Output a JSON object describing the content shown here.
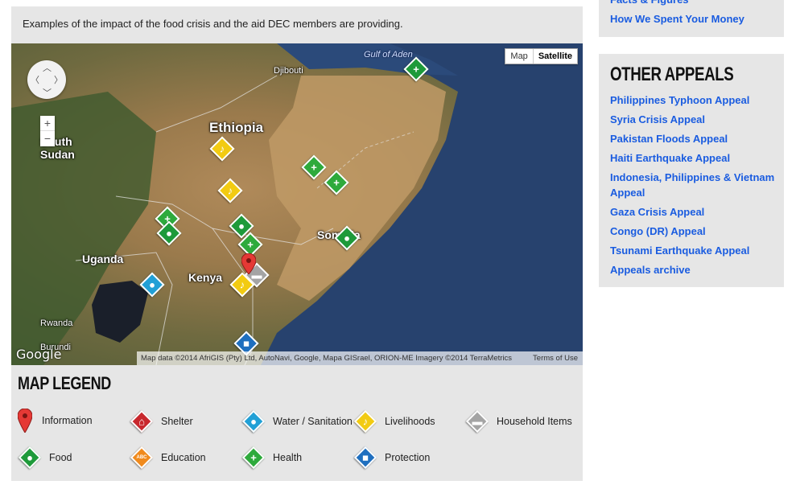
{
  "caption": "Examples of the impact of the food crisis and the aid DEC members are providing.",
  "map": {
    "type_buttons": [
      "Map",
      "Satellite"
    ],
    "selected_type": "Satellite",
    "labels": {
      "djibouti": "Djibouti",
      "ethiopia": "Ethiopia",
      "south": "South",
      "sudan": "Sudan",
      "uganda": "Uganda",
      "kenya": "Kenya",
      "somalia": "Somalia",
      "rwanda": "Rwanda",
      "burundi": "Burundi",
      "gulf": "Gulf of Aden"
    },
    "google_logo": "Google",
    "attribution": "Map data ©2014 AfriGIS (Pty) Ltd, AutoNavi, Google, Mapa GISrael, ORION-ME Imagery ©2014 TerraMetrics",
    "terms": "Terms of Use",
    "zoom_in": "+",
    "zoom_out": "−"
  },
  "legend": {
    "title": "MAP LEGEND",
    "items": [
      {
        "label": "Information",
        "icon": "information-pin-icon",
        "color": "#e53935"
      },
      {
        "label": "Shelter",
        "icon": "shelter-icon",
        "color": "#c8272d"
      },
      {
        "label": "Water / Sanitation",
        "icon": "water-drop-icon",
        "color": "#21a0d6"
      },
      {
        "label": "Livelihoods",
        "icon": "livelihoods-icon",
        "color": "#f2cb12"
      },
      {
        "label": "Household Items",
        "icon": "household-items-icon",
        "color": "#a4a4a4"
      },
      {
        "label": "Food",
        "icon": "food-apple-icon",
        "color": "#1e9a3a"
      },
      {
        "label": "Education",
        "icon": "education-abc-icon",
        "color": "#f08a1c",
        "icon_text": "ABC"
      },
      {
        "label": "Health",
        "icon": "health-cross-icon",
        "color": "#2eaa3c"
      },
      {
        "label": "Protection",
        "icon": "protection-shield-icon",
        "color": "#1f6fbf"
      }
    ]
  },
  "sidebar": {
    "top_links": [
      "Facts & Figures",
      "How We Spent Your Money"
    ],
    "other_appeals": {
      "title": "OTHER APPEALS",
      "links": [
        "Philippines Typhoon Appeal",
        "Syria Crisis Appeal",
        "Pakistan Floods Appeal",
        "Haiti Earthquake Appeal",
        "Indonesia, Philippines & Vietnam Appeal",
        "Gaza Crisis Appeal",
        "Congo (DR) Appeal",
        "Tsunami Earthquake Appeal",
        "Appeals archive"
      ]
    }
  }
}
